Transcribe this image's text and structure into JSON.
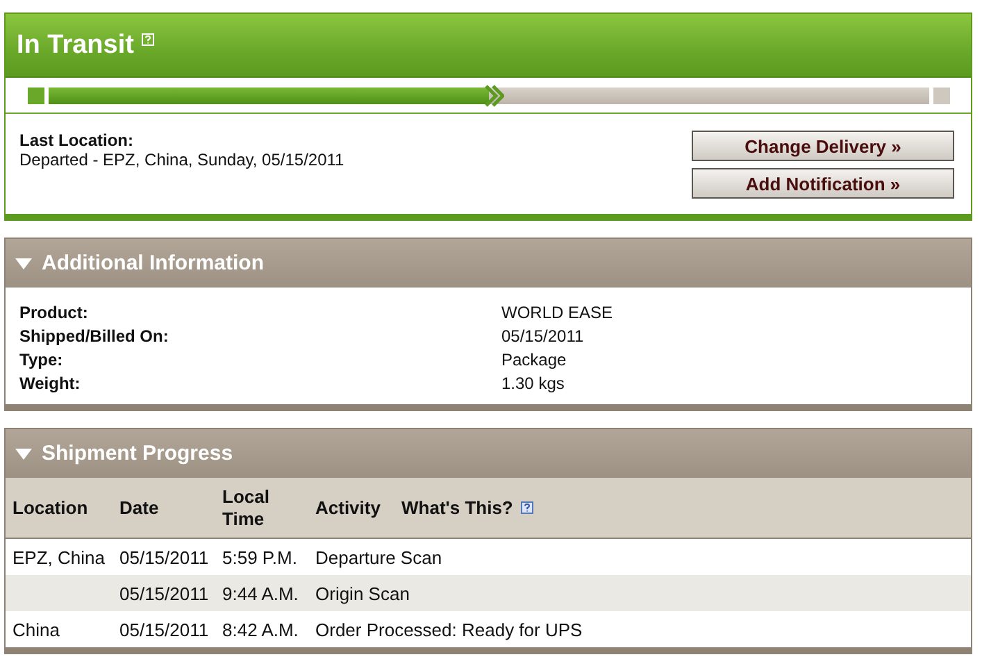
{
  "status": {
    "title": "In Transit",
    "progress": {
      "level": 0.5
    },
    "last_location_label": "Last Location:",
    "last_location": "Departed - EPZ, China, Sunday, 05/15/2011",
    "buttons": [
      "Change Delivery »",
      "Add Notification »"
    ]
  },
  "additional_information": {
    "title": "Additional Information",
    "expanded": true,
    "fields": [
      {
        "label": "Product:",
        "value": "WORLD EASE"
      },
      {
        "label": "Shipped/Billed On:",
        "value": "05/15/2011"
      },
      {
        "label": "Type:",
        "value": "Package"
      },
      {
        "label": "Weight:",
        "value": "1.30 kgs"
      }
    ]
  },
  "shipment_progress": {
    "title": "Shipment Progress",
    "expanded": true,
    "columns": [
      "Location",
      "Date",
      "Local Time",
      "Activity"
    ],
    "help_link": "What's This?",
    "rows": [
      {
        "location": "EPZ, China",
        "date": "05/15/2011",
        "time": "5:59 P.M.",
        "activity": "Departure Scan"
      },
      {
        "date": "05/15/2011",
        "time": "9:44 A.M.",
        "activity": "Origin Scan"
      },
      {
        "location": "China",
        "date": "05/15/2011",
        "time": "8:42 A.M.",
        "activity": "Order Processed: Ready for UPS"
      }
    ]
  }
}
